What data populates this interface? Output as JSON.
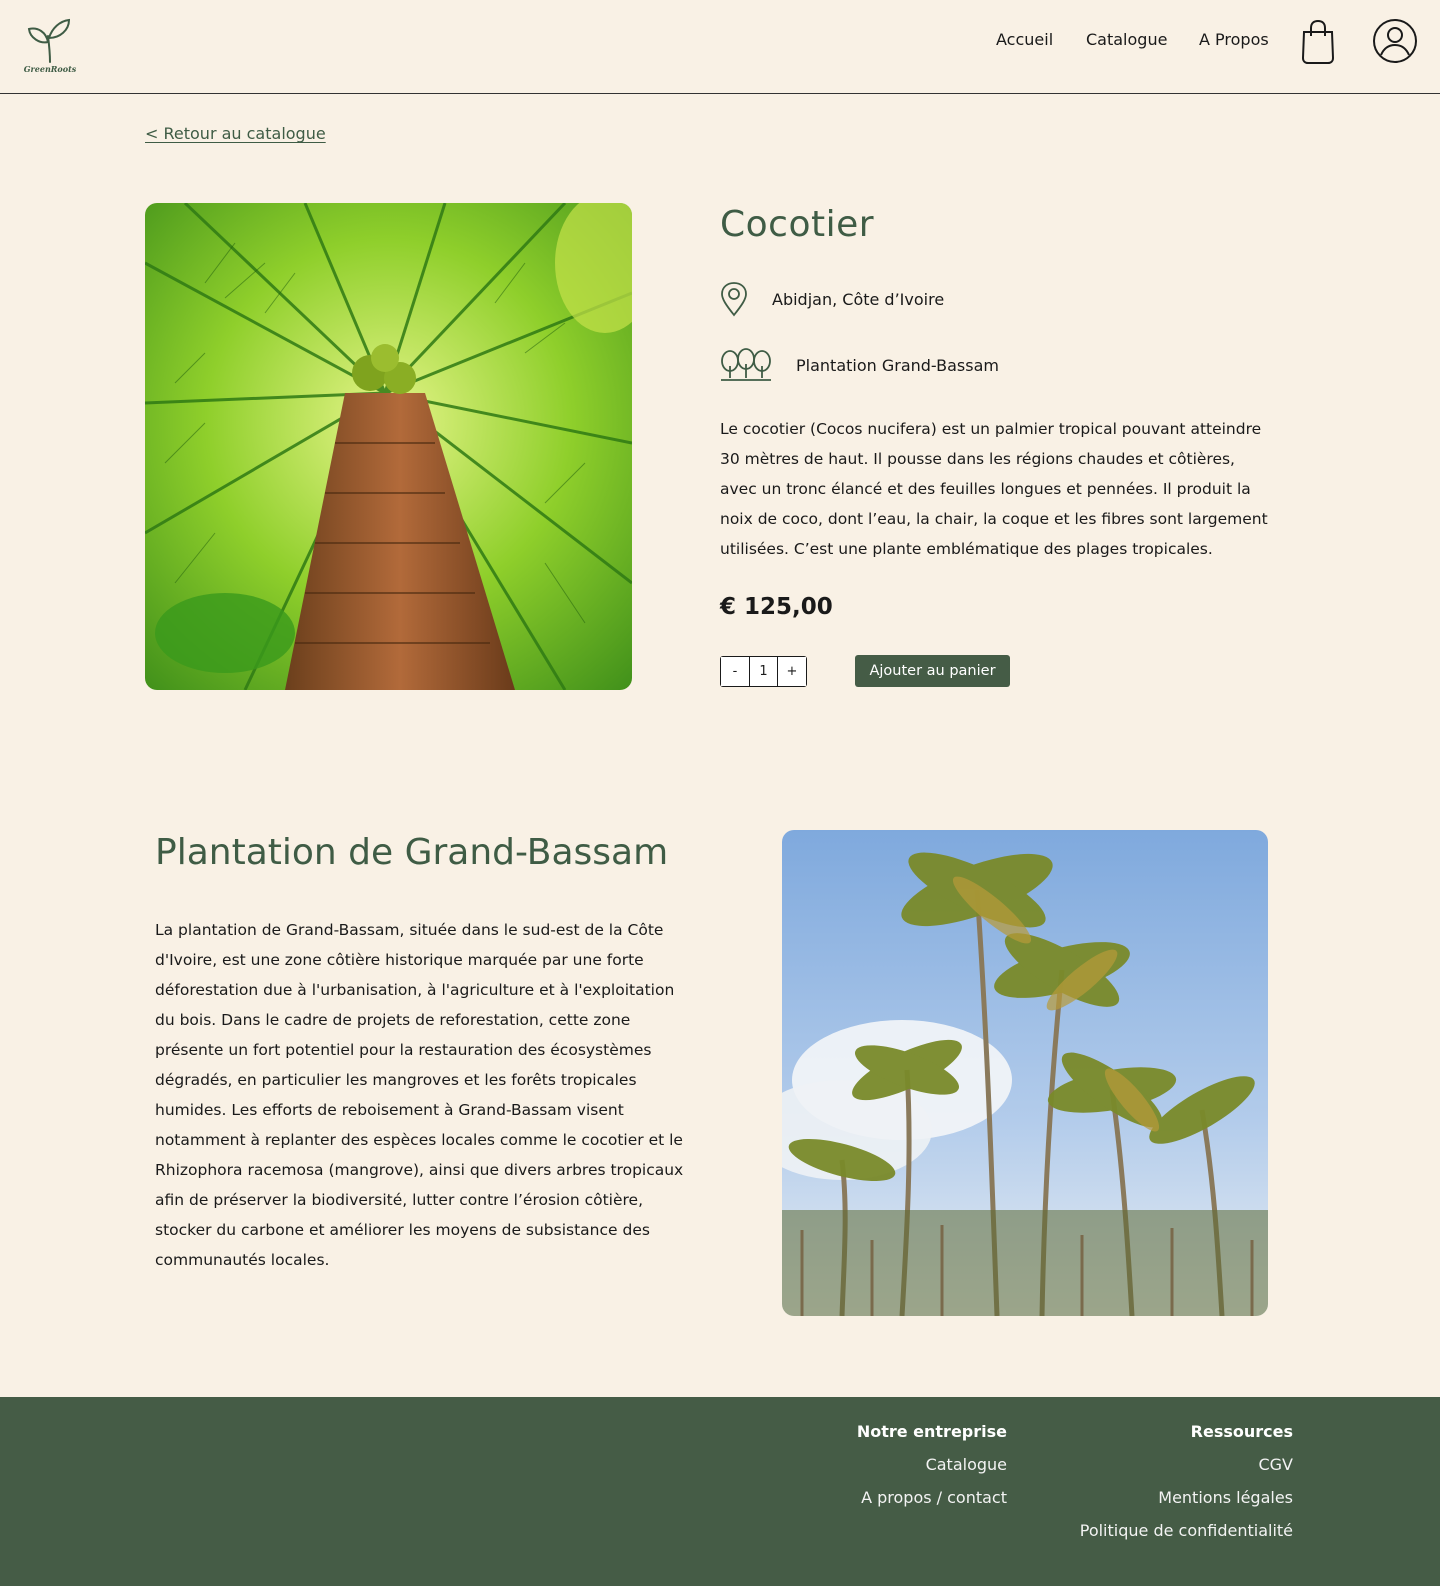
{
  "header": {
    "logo_text": "GreenRoots",
    "nav": [
      "Accueil",
      "Catalogue",
      "A Propos"
    ],
    "icons": [
      "shopping-bag-icon",
      "user-icon"
    ]
  },
  "back_link": "< Retour au catalogue",
  "product": {
    "name": "Cocotier",
    "location": "Abidjan, Côte d’Ivoire",
    "plantation": "Plantation Grand-Bassam",
    "description": "Le cocotier (Cocos nucifera) est un palmier tropical pouvant atteindre 30 mètres de haut. Il pousse dans les régions chaudes et côtières, avec un tronc élancé et des feuilles longues et pennées. Il produit la noix de coco, dont l’eau, la chair, la coque et les fibres sont largement utilisées. C’est une plante emblématique des plages tropicales.",
    "price": "€ 125,00",
    "quantity": "1",
    "qty_minus": "-",
    "qty_plus": "+",
    "add_to_cart": "Ajouter au panier"
  },
  "plantation_section": {
    "title": "Plantation de Grand-Bassam",
    "text": "La plantation de Grand-Bassam, située dans le sud-est de la Côte d'Ivoire, est une zone côtière historique marquée par une forte déforestation due à l'urbanisation, à l'agriculture et à l'exploitation du bois. Dans le cadre de projets de reforestation, cette zone présente un fort potentiel pour la restauration des écosystèmes dégradés, en particulier les mangroves et les forêts tropicales humides. Les efforts de reboisement à Grand-Bassam visent notamment à replanter des espèces locales comme le cocotier et le Rhizophora racemosa (mangrove), ainsi que divers arbres tropicaux afin de préserver la biodiversité, lutter contre l’érosion côtière, stocker du carbone et améliorer les moyens de subsistance des communautés locales."
  },
  "footer": {
    "col1": {
      "title": "Notre entreprise",
      "links": [
        "Catalogue",
        "A propos / contact"
      ]
    },
    "col2": {
      "title": "Ressources",
      "links": [
        "CGV",
        "Mentions légales",
        "Politique de confidentialité"
      ]
    }
  },
  "colors": {
    "background": "#f9f1e5",
    "accent_green": "#455c46",
    "title_green": "#3f5c45"
  }
}
